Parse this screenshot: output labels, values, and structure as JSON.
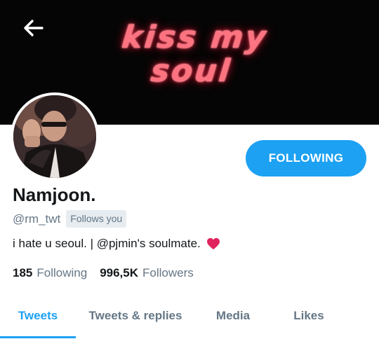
{
  "header": {
    "banner_text_line1": "kiss my",
    "banner_text_line2": "soul",
    "back_icon": "arrow-left-icon"
  },
  "profile": {
    "display_name": "Namjoon.",
    "handle": "@rm_twt",
    "follows_you_badge": "Follows you",
    "bio": "i hate u seoul. | @pjmin's soulmate.",
    "bio_emoji": "heart-icon",
    "follow_button_label": "FOLLOWING"
  },
  "stats": {
    "following_count": "185",
    "following_label": "Following",
    "followers_count": "996,5K",
    "followers_label": "Followers"
  },
  "tabs": [
    {
      "label": "Tweets",
      "active": true
    },
    {
      "label": "Tweets & replies",
      "active": false
    },
    {
      "label": "Media",
      "active": false
    },
    {
      "label": "Likes",
      "active": false
    }
  ],
  "colors": {
    "accent": "#1da1f2",
    "secondary_text": "#657786",
    "badge_bg": "#e6ecf0",
    "heart": "#e0245e",
    "banner_bg": "#050505",
    "banner_text": "#ff7380"
  }
}
